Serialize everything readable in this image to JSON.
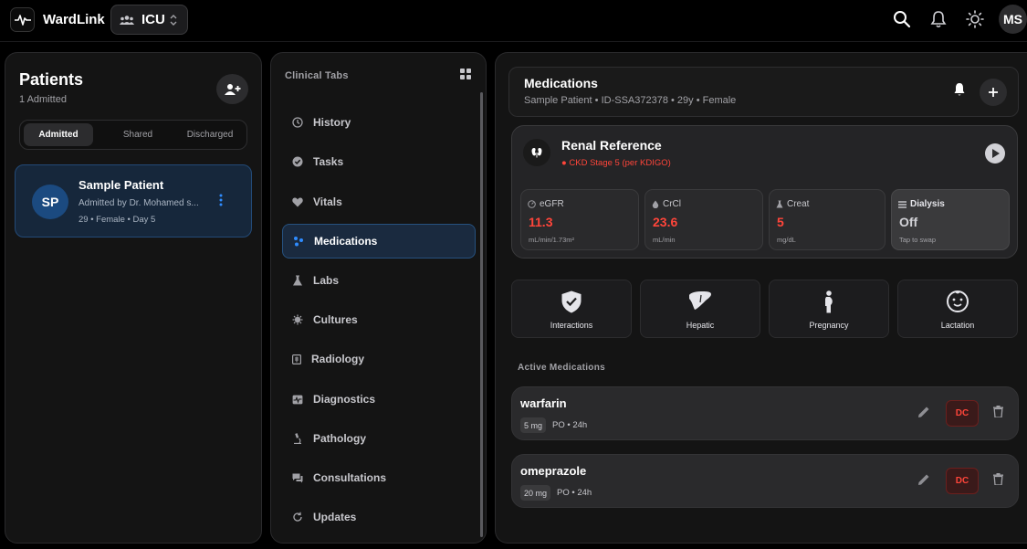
{
  "topbar": {
    "brand": "WardLink",
    "ward": "ICU",
    "user_initials": "MS",
    "icons": [
      "pulse-logo-icon",
      "search-icon",
      "bell-icon",
      "sun-icon"
    ]
  },
  "patients_panel": {
    "title": "Patients",
    "count_label": "1 Admitted",
    "tabs": [
      {
        "label": "Admitted",
        "active": true
      },
      {
        "label": "Shared",
        "active": false
      },
      {
        "label": "Discharged",
        "active": false
      }
    ],
    "patient": {
      "initials": "SP",
      "name": "Sample Patient",
      "admitted_by": "Admitted by Dr. Mohamed s...",
      "meta": "29 • Female • Day 5"
    }
  },
  "clinical_tabs": {
    "title": "Clinical Tabs",
    "items": [
      {
        "label": "History",
        "icon": "history-icon"
      },
      {
        "label": "Tasks",
        "icon": "check-circle-icon"
      },
      {
        "label": "Vitals",
        "icon": "heart-icon"
      },
      {
        "label": "Medications",
        "icon": "pills-icon",
        "active": true
      },
      {
        "label": "Labs",
        "icon": "flask-icon"
      },
      {
        "label": "Cultures",
        "icon": "microbe-icon"
      },
      {
        "label": "Radiology",
        "icon": "xray-icon"
      },
      {
        "label": "Diagnostics",
        "icon": "ecg-icon"
      },
      {
        "label": "Pathology",
        "icon": "microscope-icon"
      },
      {
        "label": "Consultations",
        "icon": "chat-icon"
      },
      {
        "label": "Updates",
        "icon": "refresh-icon"
      }
    ]
  },
  "medications": {
    "title": "Medications",
    "subtitle": "Sample Patient • ID-SSA372378 • 29y • Female",
    "renal": {
      "title": "Renal Reference",
      "stage": "● CKD Stage 5 (per KDIGO)",
      "metrics": [
        {
          "label": "eGFR",
          "value": "11.3",
          "unit": "mL/min/1.73m²"
        },
        {
          "label": "CrCl",
          "value": "23.6",
          "unit": "mL/min"
        },
        {
          "label": "Creat",
          "value": "5",
          "unit": "mg/dL"
        },
        {
          "label": "Dialysis",
          "value": "Off",
          "unit": "Tap to swap"
        }
      ]
    },
    "quick_actions": [
      {
        "label": "Interactions",
        "icon": "shield-check-icon"
      },
      {
        "label": "Hepatic",
        "icon": "liver-icon"
      },
      {
        "label": "Pregnancy",
        "icon": "pregnancy-icon"
      },
      {
        "label": "Lactation",
        "icon": "baby-face-icon"
      }
    ],
    "active_section": "Active Medications",
    "active_meds": [
      {
        "name": "warfarin",
        "dose": "5 mg",
        "route": "PO • 24h",
        "dc_label": "DC"
      },
      {
        "name": "omeprazole",
        "dose": "20 mg",
        "route": "PO • 24h",
        "dc_label": "DC"
      }
    ]
  },
  "colors": {
    "accent_blue": "#1b4a80",
    "alert_red": "#ff453a",
    "panel_bg": "#141414"
  }
}
